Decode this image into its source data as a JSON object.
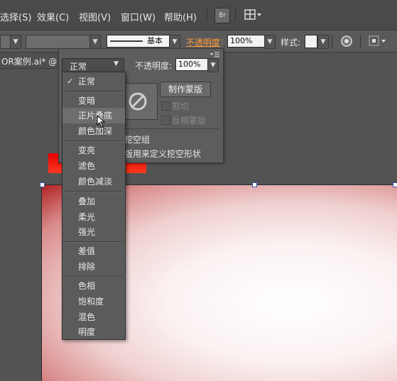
{
  "menubar": {
    "items": [
      "选择(S)",
      "效果(C)",
      "视图(V)",
      "窗口(W)",
      "帮助(H)"
    ],
    "bridge_label": "Br"
  },
  "controlbar": {
    "stroke_style_label": "基本",
    "opacity_link": "不透明度",
    "opacity_value": "100%",
    "style_label": "样式:"
  },
  "document_tab": {
    "title": "OR案例.ai* @"
  },
  "transparency_panel": {
    "blend_mode": "正常",
    "opacity_label": "不透明度:",
    "opacity_value": "100%",
    "make_mask_button": "制作蒙版",
    "clip_label": "剪切",
    "invert_mask_label": "反相蒙版",
    "knockout_group_label": "挖空组",
    "opacity_mask_knockout_label": "版用来定义挖空形状"
  },
  "blend_dropdown": {
    "selected": "正常",
    "hovered": "正片叠底",
    "groups": [
      [
        "正常"
      ],
      [
        "变暗",
        "正片叠底",
        "颜色加深"
      ],
      [
        "变亮",
        "滤色",
        "颜色减淡"
      ],
      [
        "叠加",
        "柔光",
        "强光"
      ],
      [
        "差值",
        "排除"
      ],
      [
        "色相",
        "饱和度",
        "混色",
        "明度"
      ]
    ]
  },
  "colors": {
    "accent_link": "#ff9a3c",
    "red_object": "#e60000"
  }
}
